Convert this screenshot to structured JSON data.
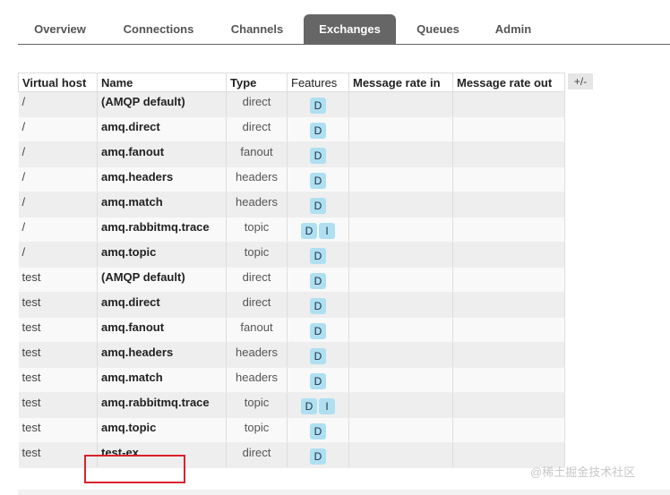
{
  "tabs": [
    {
      "label": "Overview",
      "active": false
    },
    {
      "label": "Connections",
      "active": false
    },
    {
      "label": "Channels",
      "active": false
    },
    {
      "label": "Exchanges",
      "active": true
    },
    {
      "label": "Queues",
      "active": false
    },
    {
      "label": "Admin",
      "active": false
    }
  ],
  "table": {
    "headers": [
      "Virtual host",
      "Name",
      "Type",
      "Features",
      "Message rate in",
      "Message rate out"
    ],
    "columns_toggle": "+/-",
    "rows": [
      {
        "vhost": "/",
        "name": "(AMQP default)",
        "type": "direct",
        "features": [
          "D"
        ]
      },
      {
        "vhost": "/",
        "name": "amq.direct",
        "type": "direct",
        "features": [
          "D"
        ]
      },
      {
        "vhost": "/",
        "name": "amq.fanout",
        "type": "fanout",
        "features": [
          "D"
        ]
      },
      {
        "vhost": "/",
        "name": "amq.headers",
        "type": "headers",
        "features": [
          "D"
        ]
      },
      {
        "vhost": "/",
        "name": "amq.match",
        "type": "headers",
        "features": [
          "D"
        ]
      },
      {
        "vhost": "/",
        "name": "amq.rabbitmq.trace",
        "type": "topic",
        "features": [
          "D",
          "I"
        ]
      },
      {
        "vhost": "/",
        "name": "amq.topic",
        "type": "topic",
        "features": [
          "D"
        ]
      },
      {
        "vhost": "test",
        "name": "(AMQP default)",
        "type": "direct",
        "features": [
          "D"
        ]
      },
      {
        "vhost": "test",
        "name": "amq.direct",
        "type": "direct",
        "features": [
          "D"
        ]
      },
      {
        "vhost": "test",
        "name": "amq.fanout",
        "type": "fanout",
        "features": [
          "D"
        ]
      },
      {
        "vhost": "test",
        "name": "amq.headers",
        "type": "headers",
        "features": [
          "D"
        ]
      },
      {
        "vhost": "test",
        "name": "amq.match",
        "type": "headers",
        "features": [
          "D"
        ]
      },
      {
        "vhost": "test",
        "name": "amq.rabbitmq.trace",
        "type": "topic",
        "features": [
          "D",
          "I"
        ]
      },
      {
        "vhost": "test",
        "name": "amq.topic",
        "type": "topic",
        "features": [
          "D"
        ]
      },
      {
        "vhost": "test",
        "name": "test-ex",
        "type": "direct",
        "features": [
          "D"
        ]
      }
    ]
  },
  "watermark": "@稀土掘金技术社区",
  "colors": {
    "active_tab": "#666666",
    "badge": "#aee0f2",
    "highlight": "#d9232e"
  }
}
